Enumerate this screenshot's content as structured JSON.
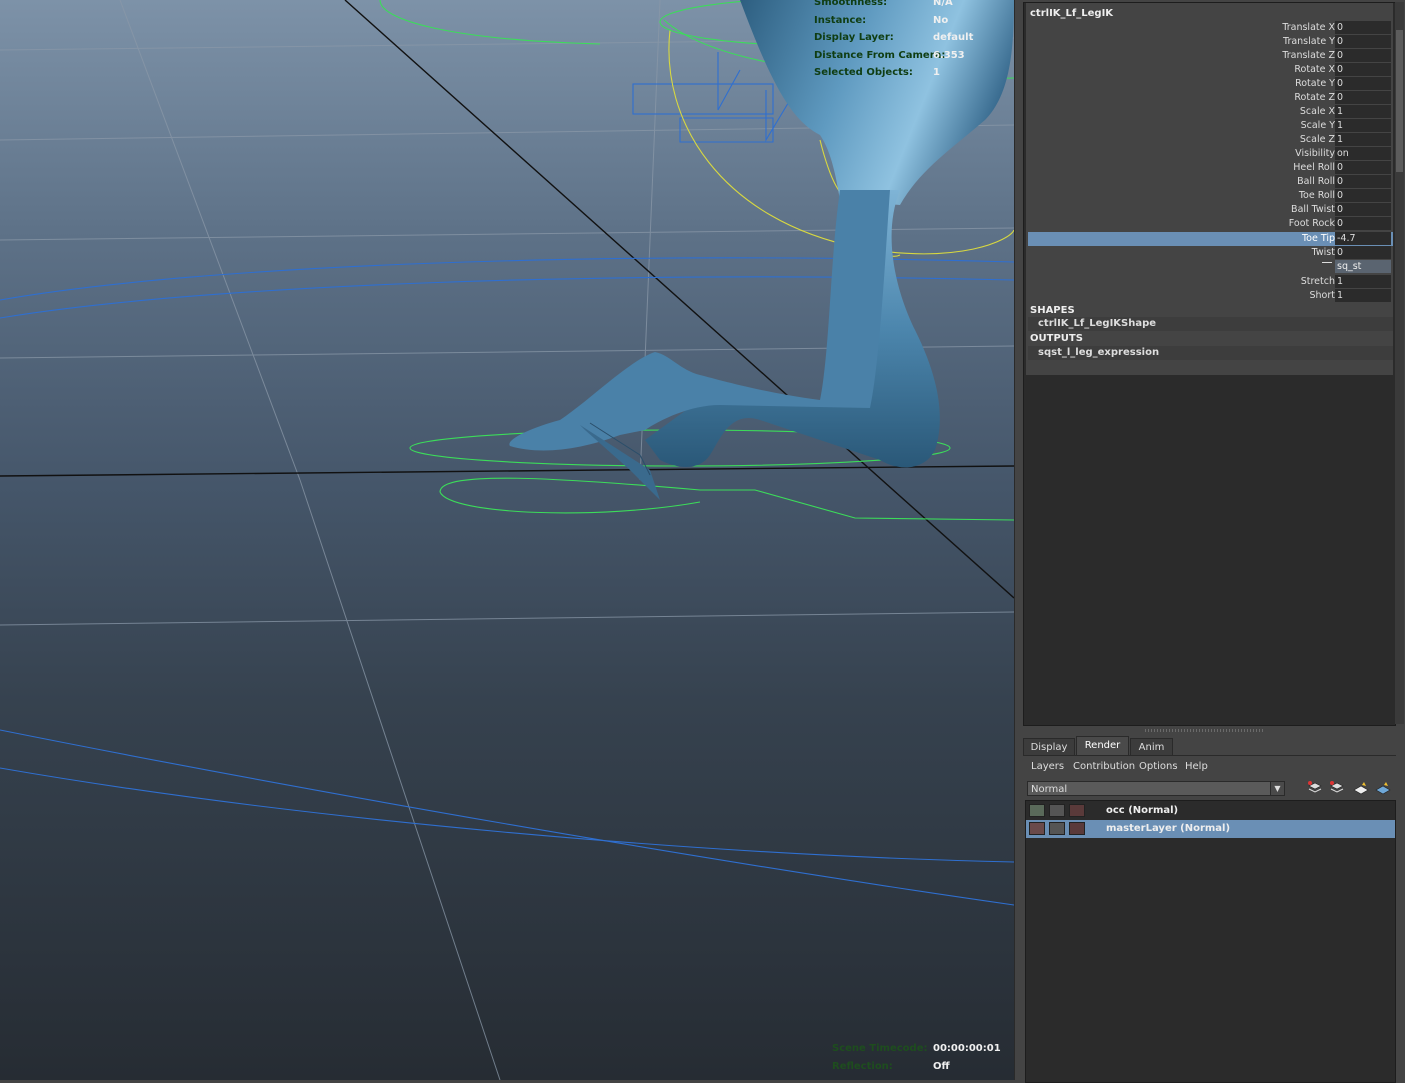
{
  "hud_top": [
    {
      "label": "Smoothness:",
      "value": "N/A"
    },
    {
      "label": "Instance:",
      "value": "No"
    },
    {
      "label": "Display Layer:",
      "value": "default"
    },
    {
      "label": "Distance From Camera:",
      "value": "6.353"
    },
    {
      "label": "Selected Objects:",
      "value": "1"
    }
  ],
  "hud_bottom": [
    {
      "label": "Scene Timecode:",
      "value": "00:00:00:01"
    },
    {
      "label": "Reflection:",
      "value": "Off"
    }
  ],
  "channel_box": {
    "title": "ctrlIK_Lf_LegIK",
    "attributes": [
      {
        "label": "Translate X",
        "value": "0"
      },
      {
        "label": "Translate Y",
        "value": "0"
      },
      {
        "label": "Translate Z",
        "value": "0"
      },
      {
        "label": "Rotate X",
        "value": "0"
      },
      {
        "label": "Rotate Y",
        "value": "0"
      },
      {
        "label": "Rotate Z",
        "value": "0"
      },
      {
        "label": "Scale X",
        "value": "1"
      },
      {
        "label": "Scale Y",
        "value": "1"
      },
      {
        "label": "Scale Z",
        "value": "1"
      },
      {
        "label": "Visibility",
        "value": "on"
      },
      {
        "label": "Heel Roll",
        "value": "0"
      },
      {
        "label": "Ball Roll",
        "value": "0"
      },
      {
        "label": "Toe Roll",
        "value": "0"
      },
      {
        "label": "Ball Twist",
        "value": "0"
      },
      {
        "label": "Foot Rock",
        "value": "0"
      },
      {
        "label": "Toe Tip",
        "value": "-4.7"
      },
      {
        "label": "Twist",
        "value": "0"
      },
      {
        "label": "",
        "value": "sq_st"
      },
      {
        "label": "Stretch",
        "value": "1"
      },
      {
        "label": "Short",
        "value": "1"
      }
    ],
    "selected_attribute": "Toe Tip",
    "shapes_header": "SHAPES",
    "shape_node": "ctrlIK_Lf_LegIKShape",
    "outputs_header": "OUTPUTS",
    "output_node": "sqst_l_leg_expression"
  },
  "layer_editor": {
    "tabs": [
      "Display",
      "Render",
      "Anim"
    ],
    "active_tab": "Render",
    "menus": [
      "Layers",
      "Contribution",
      "Options",
      "Help"
    ],
    "blend_mode": "Normal",
    "layers": [
      {
        "name": "occ (Normal)",
        "selected": false
      },
      {
        "name": "masterLayer (Normal)",
        "selected": true
      }
    ]
  },
  "colors": {
    "selection": "#6a8fb5",
    "hud_label": "#0f3d12",
    "nurbs_green": "#3cdc5a",
    "curve_yellow": "#d8d840",
    "curve_blue": "#2f6fd0",
    "mesh_blue": "#4e86ad"
  }
}
